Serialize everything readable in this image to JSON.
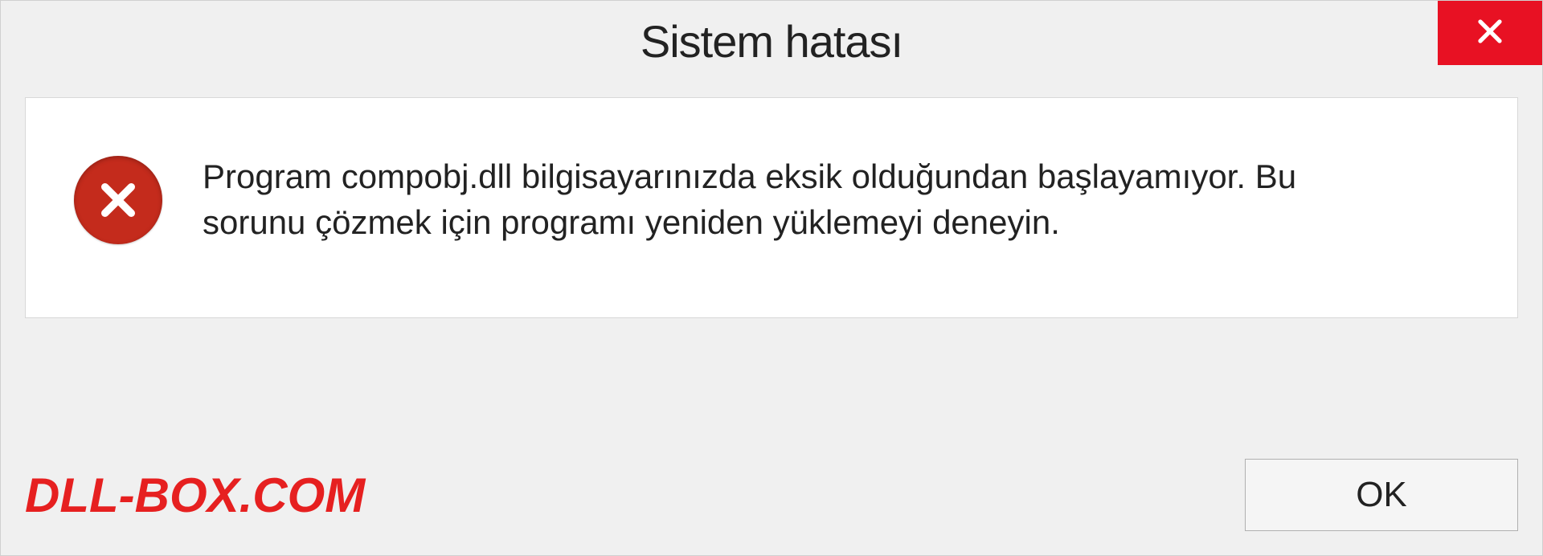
{
  "titlebar": {
    "title": "Sistem hatası"
  },
  "content": {
    "message": "Program compobj.dll bilgisayarınızda eksik olduğundan başlayamıyor. Bu sorunu çözmek için programı yeniden yüklemeyi deneyin."
  },
  "footer": {
    "watermark": "DLL-BOX.COM",
    "ok_label": "OK"
  },
  "colors": {
    "close_button_bg": "#e81123",
    "error_icon_bg": "#c42b1c",
    "watermark_color": "#e62020"
  }
}
